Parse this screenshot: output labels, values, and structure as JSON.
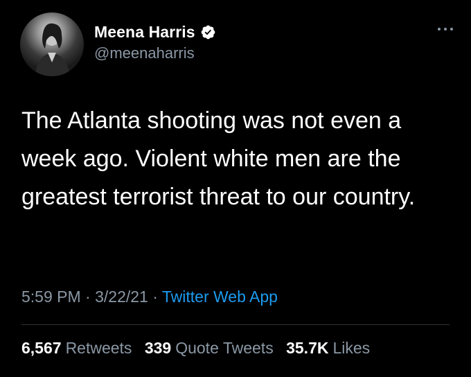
{
  "author": {
    "display_name": "Meena Harris",
    "handle": "@meenaharris",
    "verified": true,
    "avatar_icon": "avatar-photo"
  },
  "menu_icon": "more-dots-icon",
  "tweet": {
    "text": "The Atlanta shooting was not even a week ago. Violent white men are the greatest terrorist threat to our country.",
    "time": "5:59 PM",
    "separator": "·",
    "date": "3/22/21",
    "source": "Twitter Web App"
  },
  "stats": {
    "retweets_count": "6,567",
    "retweets_label": "Retweets",
    "quotes_count": "339",
    "quotes_label": "Quote Tweets",
    "likes_count": "35.7K",
    "likes_label": "Likes"
  },
  "colors": {
    "background": "#000000",
    "primary_text": "#ffffff",
    "secondary_text": "#8b98a5",
    "link": "#1d9bf0",
    "divider": "#2f3336"
  }
}
